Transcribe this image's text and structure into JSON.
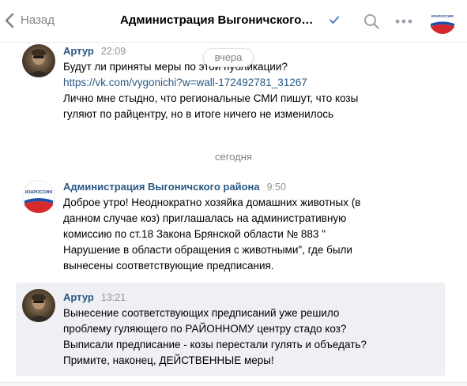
{
  "header": {
    "back_label": "Назад",
    "title": "Администрация Выгоничского ра...",
    "avatar_text": "ИЗАРОССИЮ"
  },
  "date_pill": "вчера",
  "divider": "сегодня",
  "messages": [
    {
      "author": "Артур",
      "time": "22:09",
      "lines": [
        "Будут ли приняты меры по этой публикации?",
        "https://vk.com/vygonichi?w=wall-172492781_31267",
        "Лично мне стыдно, что региональные СМИ пишут, что козы",
        "гуляют по райцентру, но в итоге ничего не изменилось"
      ]
    },
    {
      "author": "Администрация Выгоничского района",
      "time": "9:50",
      "avatar_text": "ИЗАРОССИЮ",
      "lines": [
        "Доброе утро! Неоднократно хозяйка домашних животных (в",
        "данном случае коз) приглашалась на административную",
        "комиссию по ст.18 Закона Брянской области № 883 \"",
        "Нарушение в области обращения с животными\", где были",
        "вынесены соответствующие предписания."
      ]
    },
    {
      "author": "Артур",
      "time": "13:21",
      "lines": [
        "Вынесение соответствующих предписаний уже решило",
        "проблему гуляющего по РАЙОННОМУ центру стадо коз?",
        "Выписали предписание - козы перестали гулять и объедать?",
        "Примите, наконец, ДЕЙСТВЕННЫЕ меры!"
      ]
    }
  ]
}
